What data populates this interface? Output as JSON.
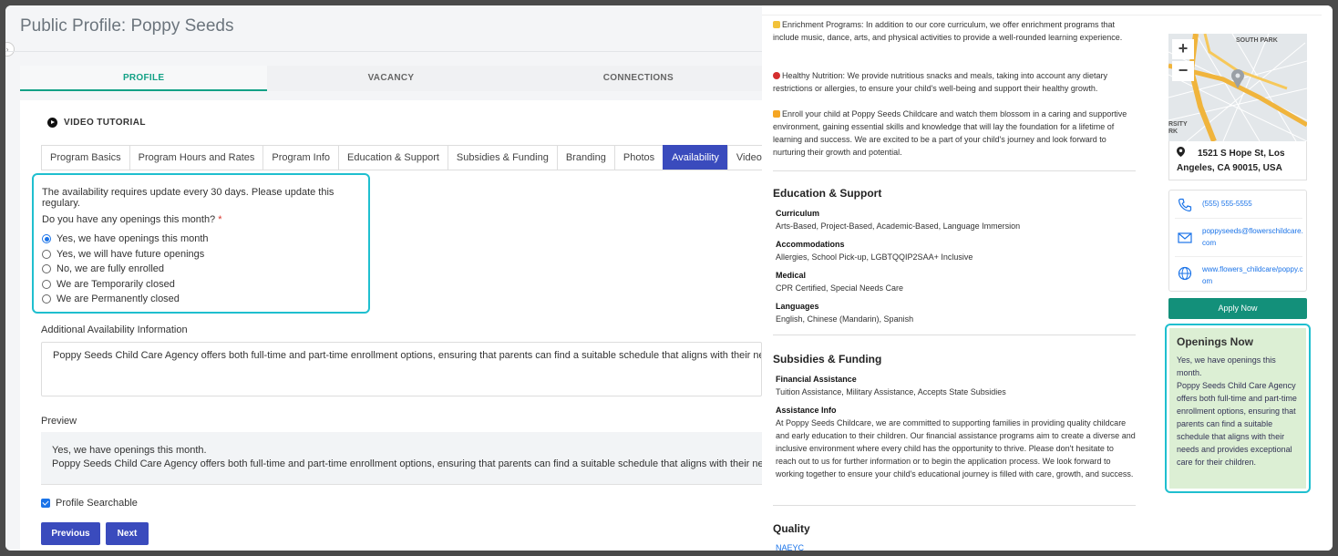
{
  "page_title": "Public Profile: Poppy Seeds",
  "main_tabs": [
    "PROFILE",
    "VACANCY",
    "CONNECTIONS"
  ],
  "video_tutorial": "VIDEO TUTORIAL",
  "sub_tabs": [
    "Program Basics",
    "Program Hours and Rates",
    "Program Info",
    "Education & Support",
    "Subsidies & Funding",
    "Branding",
    "Photos",
    "Availability",
    "Video"
  ],
  "availability": {
    "note": "The availability requires update every 30 days. Please update this regulary.",
    "question": "Do you have any openings this month?",
    "required_mark": "*",
    "options": [
      "Yes, we have openings this month",
      "Yes, we will have future openings",
      "No, we are fully enrolled",
      "We are Temporarily closed",
      "We are Permanently closed"
    ]
  },
  "additional": {
    "label": "Additional Availability Information",
    "value": "Poppy Seeds Child Care Agency offers both full-time and part-time enrollment options, ensuring that parents can find a suitable schedule that aligns with their needs and provides exceptional care for their children."
  },
  "preview": {
    "label": "Preview",
    "line1": "Yes, we have openings this month.",
    "line2": "Poppy Seeds Child Care Agency offers both full-time and part-time enrollment options, ensuring that parents can find a suitable schedule that aligns with their needs and provides exceptional care for their children."
  },
  "profile_searchable": "Profile Searchable",
  "buttons": {
    "previous": "Previous",
    "next": "Next"
  },
  "right": {
    "enrichment": "Enrichment Programs: In addition to our core curriculum, we offer enrichment programs that include music, dance, arts, and physical activities to provide a well-rounded learning experience.",
    "nutrition": "Healthy Nutrition: We provide nutritious snacks and meals, taking into account any dietary restrictions or allergies, to ensure your child's well-being and support their healthy growth.",
    "enroll": "Enroll your child at Poppy Seeds Childcare and watch them blossom in a caring and supportive environment, gaining essential skills and knowledge that will lay the foundation for a lifetime of learning and success. We are excited to be a part of your child's journey and look forward to nurturing their growth and potential.",
    "edu_title": "Education & Support",
    "curriculum_label": "Curriculum",
    "curriculum": "Arts-Based, Project-Based, Academic-Based, Language Immersion",
    "accommodations_label": "Accommodations",
    "accommodations": "Allergies, School Pick-up, LGBTQQIP2SAA+ Inclusive",
    "medical_label": "Medical",
    "medical": "CPR Certified, Special Needs Care",
    "languages_label": "Languages",
    "languages": "English, Chinese (Mandarin), Spanish",
    "subsidies_title": "Subsidies & Funding",
    "financial_label": "Financial Assistance",
    "financial": "Tuition Assistance, Military Assistance, Accepts State Subsidies",
    "assist_label": "Assistance Info",
    "assist": "At Poppy Seeds Childcare, we are committed to supporting families in providing quality childcare and early education to their children. Our financial assistance programs aim to create a diverse and inclusive environment where every child has the opportunity to thrive. Please don't hesitate to reach out to us for further information or to begin the application process. We look forward to working together to ensure your child's educational journey is filled with care, growth, and success.",
    "quality_title": "Quality",
    "quality_item": "NAEYC"
  },
  "sidebar": {
    "map_labels": {
      "south_park": "SOUTH PARK",
      "city": "RSITY\nRK"
    },
    "zoom_in": "+",
    "zoom_out": "−",
    "address": "1521 S Hope St, Los Angeles, CA 90015, USA",
    "phone": "(555) 555-5555",
    "email": "poppyseeds@flowerschildcare.com",
    "website": "www.flowers_childcare/poppy.com",
    "apply": "Apply Now",
    "openings_title": "Openings Now",
    "openings_line1": "Yes, we have openings this month.",
    "openings_line2": "Poppy Seeds Child Care Agency offers both full-time and part-time enrollment options, ensuring that parents can find a suitable schedule that aligns with their needs and provides exceptional care for their children."
  },
  "colors": {
    "accent_teal": "#13a186",
    "primary_blue": "#3a4bbd",
    "highlight_cyan": "#1fbfcf",
    "openings_bg": "#dcefd4"
  }
}
